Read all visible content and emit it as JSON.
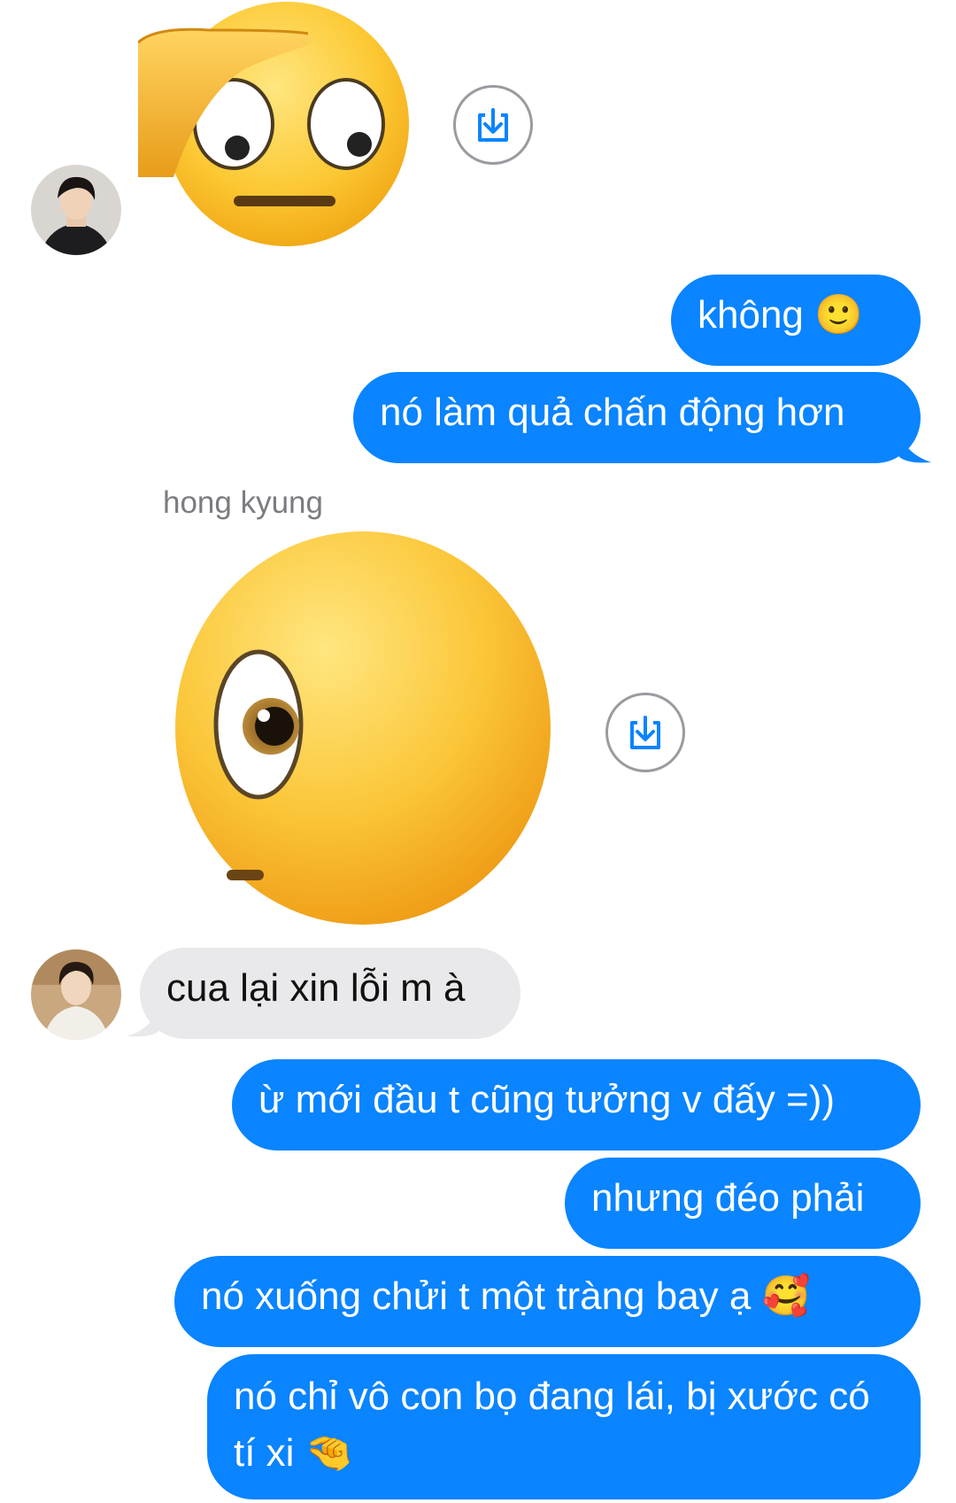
{
  "conversation": {
    "sender_name": "hong kyung",
    "messages": [
      {
        "from": "them",
        "type": "sticker",
        "sticker": "face-with-hand-over-eye-sticker"
      },
      {
        "from": "me",
        "text": "không 🙂"
      },
      {
        "from": "me",
        "text": "nó làm quả chấn động hơn"
      },
      {
        "from": "them",
        "type": "sticker",
        "sticker": "face-with-one-eye-sticker"
      },
      {
        "from": "them",
        "text": "cua lại xin lỗi m à"
      },
      {
        "from": "me",
        "text": "ừ mới đầu t cũng tưởng v đấy =))"
      },
      {
        "from": "me",
        "text": "nhưng đéo phải"
      },
      {
        "from": "me",
        "text": "nó xuống chửi t một tràng bay ạ 🥰"
      },
      {
        "from": "me",
        "text": "nó chỉ vô con bọ đang lái, bị xước có tí xi 🤏"
      }
    ]
  },
  "icons": {
    "save_sticker": "download-tray-icon",
    "avatar": "contact-avatar"
  },
  "colors": {
    "outgoing_bubble": "#0a84ff",
    "incoming_bubble": "#e9e9eb",
    "background": "#ffffff",
    "sender_name": "#7b7b80"
  }
}
